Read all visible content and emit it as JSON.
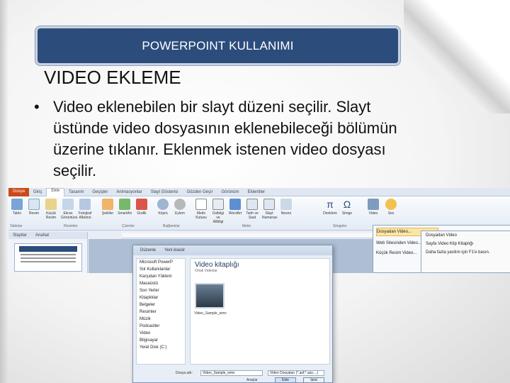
{
  "slide": {
    "title": "POWERPOINT KULLANIMI",
    "heading": "VIDEO EKLEME",
    "bullets": [
      {
        "lines": [
          "Video eklenebilen bir slayt düzeni seçilir. Slayt",
          "üstünde video dosyasının eklenebileceği bölümün",
          "üzerine tıklanır. Eklenmek istenen video dosyası",
          "seçilir."
        ]
      }
    ],
    "bullet_char": "•"
  },
  "screenshot": {
    "menu": {
      "file": "Dosya",
      "items": [
        "Giriş",
        "Ekle",
        "Tasarım",
        "Geçişler",
        "Animasyonlar",
        "Slayt Gösterisi",
        "Gözden Geçir",
        "Görünüm",
        "Eklentiler"
      ]
    },
    "ribbon_groups": [
      "Tablolar",
      "Resimler",
      "Çizimler",
      "Bağlantılar",
      "Metin",
      "Simgeler"
    ],
    "ribbon_items": [
      "Tablo",
      "Resim",
      "Küçük Resim",
      "Ekran Görüntüsü",
      "Fotoğraf Albümü",
      "Şekiller",
      "SmartArt",
      "Grafik",
      "Köprü",
      "Eylem",
      "Metin Kutusu",
      "Üstbilgi ve Altbilgi",
      "WordArt",
      "Tarih ve Saat",
      "Slayt Numarası",
      "Nesne",
      "Denklem",
      "Simge",
      "Video",
      "Ses"
    ],
    "panel_tabs": [
      "Slaytlar",
      "Anahat"
    ],
    "video_menu": [
      "Dosyadan Video...",
      "Web Sitesinden Video...",
      "Küçük Resim Video..."
    ],
    "video_submenu": [
      "Dosyadan Video",
      "Sayfa Video Klip Kitaplığı",
      "Daha fazla yardım için F1'e basın."
    ],
    "dialog": {
      "breadcrumb": [
        "Düzenle",
        "Yeni klasör"
      ],
      "tree": [
        "Microsoft PowerP",
        "Sık Kullanılanlar",
        "Karşıdan Yüklem",
        "Masaüstü",
        "Son Yerler",
        "Kitaplıklar",
        "Belgeler",
        "Resimler",
        "Müzik",
        "Podcastler",
        "Video",
        "Bilgisayar",
        "Yerel Disk (C:)"
      ],
      "library_title": "Video kitaplığı",
      "library_subtitle": "Ortak Videolar",
      "video_label": "Video_Sample_wmv",
      "filename_label": "Dosya adı:",
      "filename_value": "Video_Sample_wmv",
      "filter_value": "Video Dosyaları (*.asf;*.asx;...)",
      "tools_label": "Araçlar",
      "ok_label": "Ekle",
      "cancel_label": "İptal"
    }
  }
}
